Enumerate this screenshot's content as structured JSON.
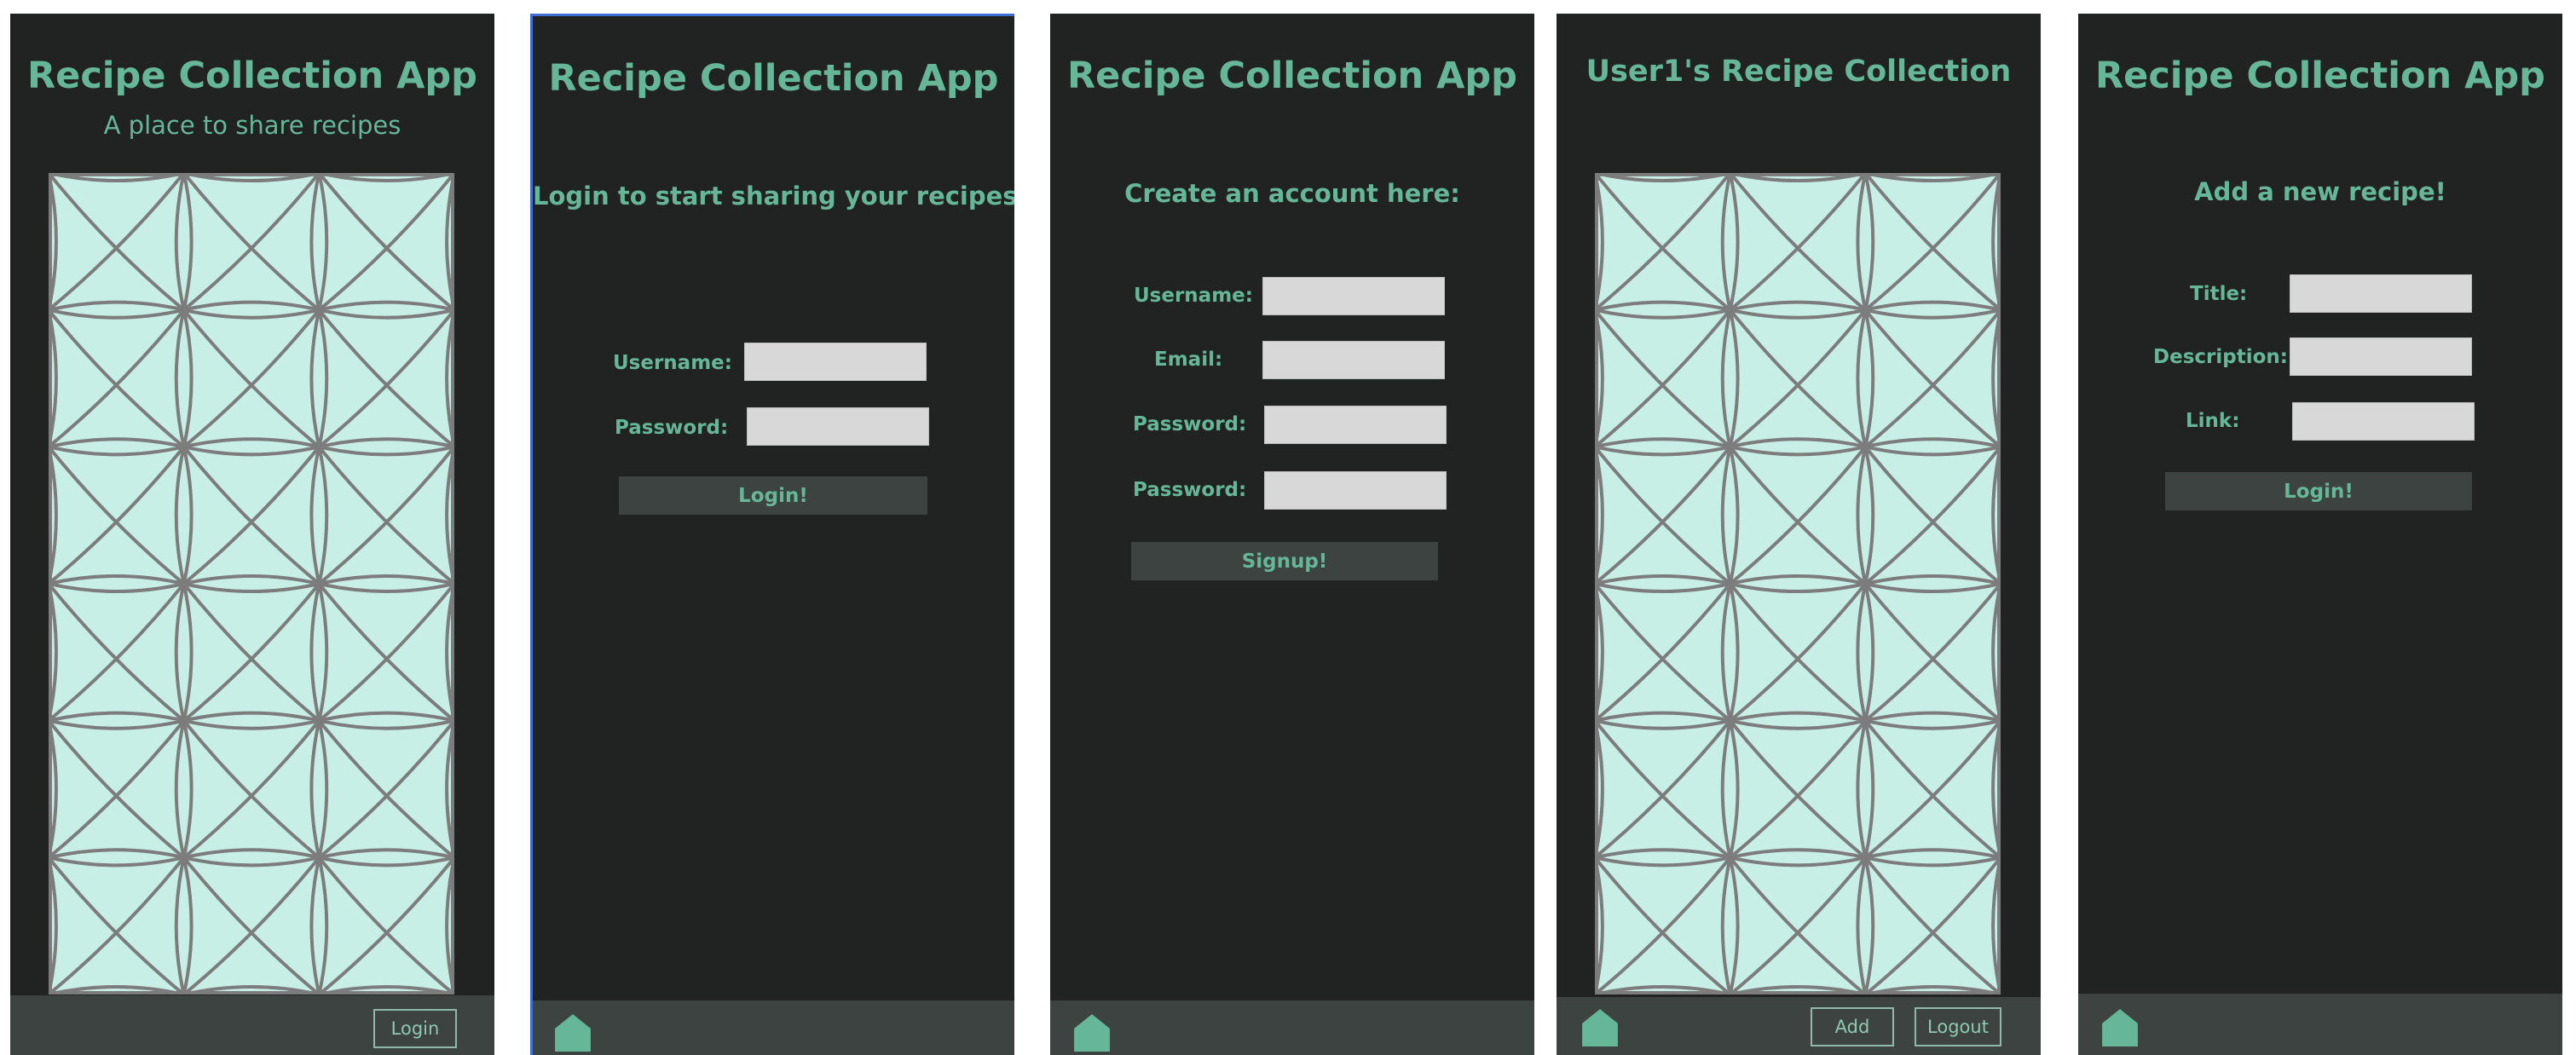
{
  "colors": {
    "screen_bg": "#212222",
    "accent": "#66b79a",
    "footer_bg": "#3c4341",
    "grid_fill": "#c8efe5",
    "grid_stroke": "#7c7c7c",
    "input_bg": "#d8d8d8"
  },
  "screens": [
    {
      "title": "Recipe Collection App",
      "subtitle": "A place to share recipes",
      "footer": {
        "login_button": "Login"
      }
    },
    {
      "title": "Recipe Collection App",
      "heading": "Login to start sharing your recipes!",
      "fields": [
        {
          "label": "Username:",
          "value": ""
        },
        {
          "label": "Password:",
          "value": ""
        }
      ],
      "button": "Login!",
      "footer": {
        "icon": "home-icon"
      }
    },
    {
      "title": "Recipe Collection App",
      "heading": "Create an account here:",
      "fields": [
        {
          "label": "Username:",
          "value": ""
        },
        {
          "label": "Email:",
          "value": ""
        },
        {
          "label": "Password:",
          "value": ""
        },
        {
          "label": "Password:",
          "value": ""
        }
      ],
      "button": "Signup!",
      "footer": {
        "icon": "home-icon"
      }
    },
    {
      "title": "User1's Recipe Collection",
      "footer": {
        "icon": "home-icon",
        "add_button": "Add",
        "logout_button": "Logout"
      }
    },
    {
      "title": "Recipe Collection App",
      "heading": "Add a new recipe!",
      "fields": [
        {
          "label": "Title:",
          "value": ""
        },
        {
          "label": "Description:",
          "value": ""
        },
        {
          "label": "Link:",
          "value": ""
        }
      ],
      "button": "Login!",
      "footer": {
        "icon": "home-icon"
      }
    }
  ]
}
